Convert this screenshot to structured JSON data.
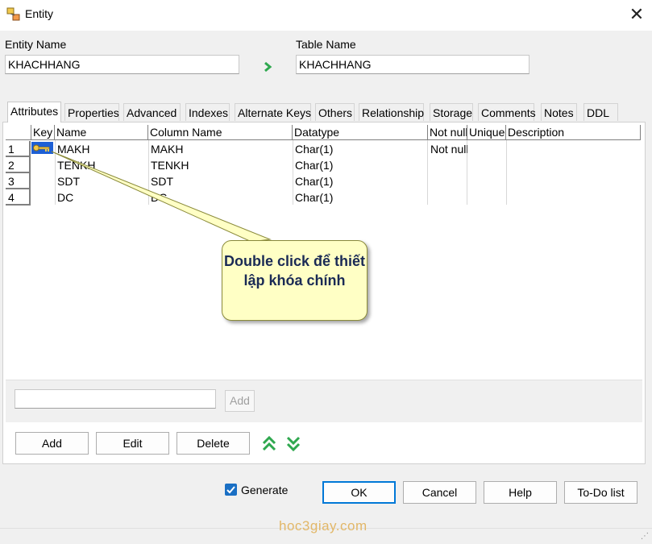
{
  "window": {
    "title": "Entity",
    "app_icon": "entity-icon",
    "close_icon": "close-icon"
  },
  "entity_name": {
    "label": "Entity Name",
    "value": "KHACHHANG"
  },
  "table_name": {
    "label": "Table Name",
    "value": "KHACHHANG"
  },
  "tabs": [
    {
      "label": "Attributes",
      "active": true
    },
    {
      "label": "Properties"
    },
    {
      "label": "Advanced"
    },
    {
      "label": "Indexes"
    },
    {
      "label": "Alternate Keys"
    },
    {
      "label": "Others"
    },
    {
      "label": "Relationship"
    },
    {
      "label": "Storage"
    },
    {
      "label": "Comments"
    },
    {
      "label": "Notes"
    },
    {
      "label": "DDL"
    }
  ],
  "grid": {
    "columns": [
      "Key",
      "Name",
      "Column Name",
      "Datatype",
      "Not null",
      "Unique",
      "Description"
    ],
    "rows": [
      {
        "num": "1",
        "name": "MAKH",
        "column": "MAKH",
        "datatype": "Char(1)",
        "not_null": "Not null",
        "key": true
      },
      {
        "num": "2",
        "name": "TENKH",
        "column": "TENKH",
        "datatype": "Char(1)",
        "not_null": ""
      },
      {
        "num": "3",
        "name": "SDT",
        "column": "SDT",
        "datatype": "Char(1)",
        "not_null": ""
      },
      {
        "num": "4",
        "name": "DC",
        "column": "DC",
        "datatype": "Char(1)",
        "not_null": ""
      }
    ]
  },
  "callout": {
    "text": "Double click để thiết lập khóa chính"
  },
  "add_input": {
    "value": ""
  },
  "buttons": {
    "add_small": "Add",
    "add": "Add",
    "edit": "Edit",
    "delete": "Delete",
    "ok": "OK",
    "cancel": "Cancel",
    "help": "Help",
    "todo": "To-Do list"
  },
  "generate": {
    "label": "Generate",
    "checked": true
  },
  "watermark": "hoc3giay.com",
  "colors": {
    "accent": "#0078d7",
    "callout_bg": "#ffffc5",
    "move_arrows": "#2fa84f"
  }
}
